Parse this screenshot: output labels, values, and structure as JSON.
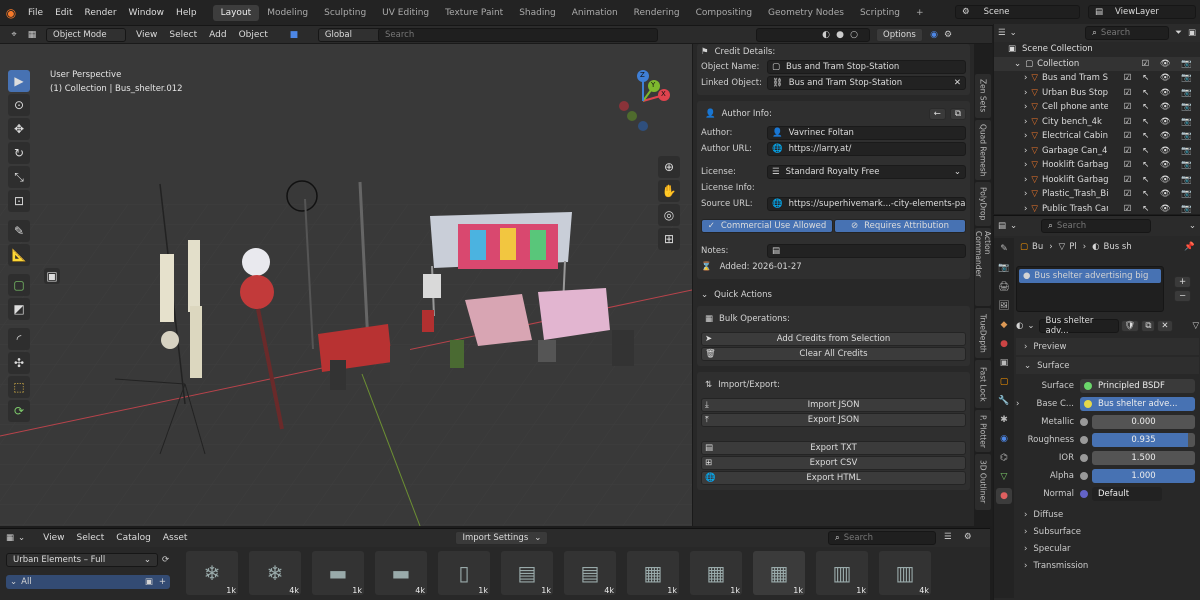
{
  "menus": [
    "File",
    "Edit",
    "Render",
    "Window",
    "Help"
  ],
  "workspaces": [
    "Layout",
    "Modeling",
    "Sculpting",
    "UV Editing",
    "Texture Paint",
    "Shading",
    "Animation",
    "Rendering",
    "Compositing",
    "Geometry Nodes",
    "Scripting"
  ],
  "workspace_add": "+",
  "scene": "Scene",
  "view_layer": "ViewLayer",
  "viewport_header": {
    "mode": "Object Mode",
    "menus": [
      "View",
      "Select",
      "Add",
      "Object"
    ],
    "orientation": "Global",
    "search_placeholder": "Search",
    "options": "Options"
  },
  "viewport": {
    "line1": "User Perspective",
    "line2": "(1) Collection | Bus_shelter.012"
  },
  "gizmo": {
    "x": "X",
    "y": "Y",
    "z": "Z"
  },
  "npanel": {
    "credit_details": "Credit Details:",
    "object_name_label": "Object Name:",
    "object_name": "Bus and Tram Stop-Station",
    "linked_object_label": "Linked Object:",
    "linked_object": "Bus and Tram Stop-Station",
    "author_info": "Author Info:",
    "author_label": "Author:",
    "author": "Vavrinec Foltan",
    "author_url_label": "Author URL:",
    "author_url": "https://larry.at/",
    "license_label": "License:",
    "license": "Standard Royalty Free",
    "license_info_label": "License Info:",
    "source_url_label": "Source URL:",
    "source_url": "https://superhivemark...-city-elements-pack",
    "commercial": "Commercial Use Allowed",
    "attribution": "Requires Attribution",
    "notes_label": "Notes:",
    "added": "Added: 2026-01-27",
    "quick_actions": "Quick Actions",
    "bulk_operations": "Bulk Operations:",
    "add_credits": "Add Credits from Selection",
    "clear_credits": "Clear All Credits",
    "import_export": "Import/Export:",
    "import_json": "Import JSON",
    "export_json": "Export JSON",
    "export_txt": "Export TXT",
    "export_csv": "Export CSV",
    "export_html": "Export HTML"
  },
  "side_tabs": [
    "Zen Sets",
    "Quad Remesh",
    "PolyDrop",
    "Action Commander",
    "TrueDepth",
    "Fast Lock",
    "P. Plotter",
    "3D Outliner"
  ],
  "outliner": {
    "search_placeholder": "Search",
    "scene_collection": "Scene Collection",
    "collection": "Collection",
    "items": [
      "Bus and Tram Sto",
      "Urban Bus Stop v",
      "Cell phone anten",
      "City bench_4k",
      "Electrical Cabinet",
      "Garbage Can_4k",
      "Hooklift Garbage",
      "Hooklift Garbage",
      "Plastic_Trash_Bin",
      "Public Trash Can"
    ]
  },
  "properties": {
    "search_placeholder": "Search",
    "breadcrumb": [
      "Bu",
      "Pl",
      "Bus sh"
    ],
    "material_slot": "Bus shelter advertising big",
    "material_name": "Bus shelter adv...",
    "preview": "Preview",
    "surface": "Surface",
    "surface_label": "Surface",
    "surface_value": "Principled BSDF",
    "base_color_label": "Base C...",
    "base_color_value": "Bus shelter adve...",
    "metallic_label": "Metallic",
    "metallic": "0.000",
    "roughness_label": "Roughness",
    "roughness": "0.935",
    "roughness_fill": 0.935,
    "ior_label": "IOR",
    "ior": "1.500",
    "alpha_label": "Alpha",
    "alpha": "1.000",
    "alpha_fill": 1.0,
    "normal_label": "Normal",
    "normal": "Default",
    "diffuse": "Diffuse",
    "subsurface": "Subsurface",
    "specular": "Specular",
    "transmission": "Transmission"
  },
  "asset_browser": {
    "menus": [
      "View",
      "Select",
      "Catalog",
      "Asset"
    ],
    "library": "Urban Elements – Full",
    "import_settings": "Import Settings",
    "search_placeholder": "Search",
    "catalog_all": "All",
    "thumbs": [
      {
        "badge": "1k"
      },
      {
        "badge": "4k"
      },
      {
        "badge": "1k"
      },
      {
        "badge": "4k"
      },
      {
        "badge": "1k"
      },
      {
        "badge": "1k"
      },
      {
        "badge": "4k"
      },
      {
        "badge": "1k"
      },
      {
        "badge": "1k"
      },
      {
        "badge": "1k"
      },
      {
        "badge": "1k"
      },
      {
        "badge": "4k"
      }
    ]
  },
  "colors": {
    "accent": "#4772b3",
    "x_axis": "#e0434e",
    "y_axis": "#7eb82e",
    "z_axis": "#3f7fd6"
  }
}
